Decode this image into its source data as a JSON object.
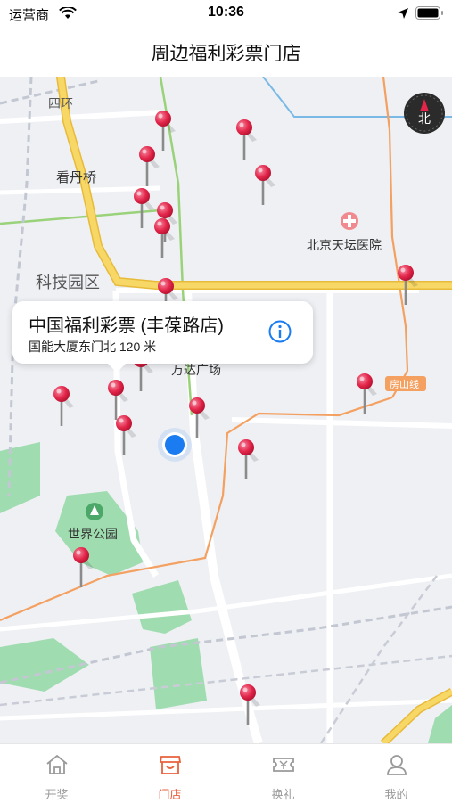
{
  "status_bar": {
    "carrier": "运营商",
    "time": "10:36"
  },
  "navbar": {
    "title": "周边福利彩票门店"
  },
  "map": {
    "labels": {
      "ring_road": "四环",
      "kandan_bridge": "看丹桥",
      "tech_park": "科技园区",
      "hospital": "北京天坛医院",
      "wanda": "万达广场",
      "fangshan_line": "房山线",
      "world_park": "世界公园"
    },
    "compass_label": "北",
    "callout": {
      "title": "中国福利彩票 (丰葆路店)",
      "address": "国能大厦东门北 120 米"
    }
  },
  "tabbar": {
    "items": [
      {
        "label": "开奖",
        "icon": "home-icon"
      },
      {
        "label": "门店",
        "icon": "store-icon"
      },
      {
        "label": "换礼",
        "icon": "ticket-icon"
      },
      {
        "label": "我的",
        "icon": "user-icon"
      }
    ],
    "active_index": 1
  },
  "colors": {
    "accent": "#e8603c",
    "pin": "#e3254a",
    "user_location": "#1a7cf0",
    "major_road": "#f5cf55",
    "park": "#9fdcaf"
  }
}
